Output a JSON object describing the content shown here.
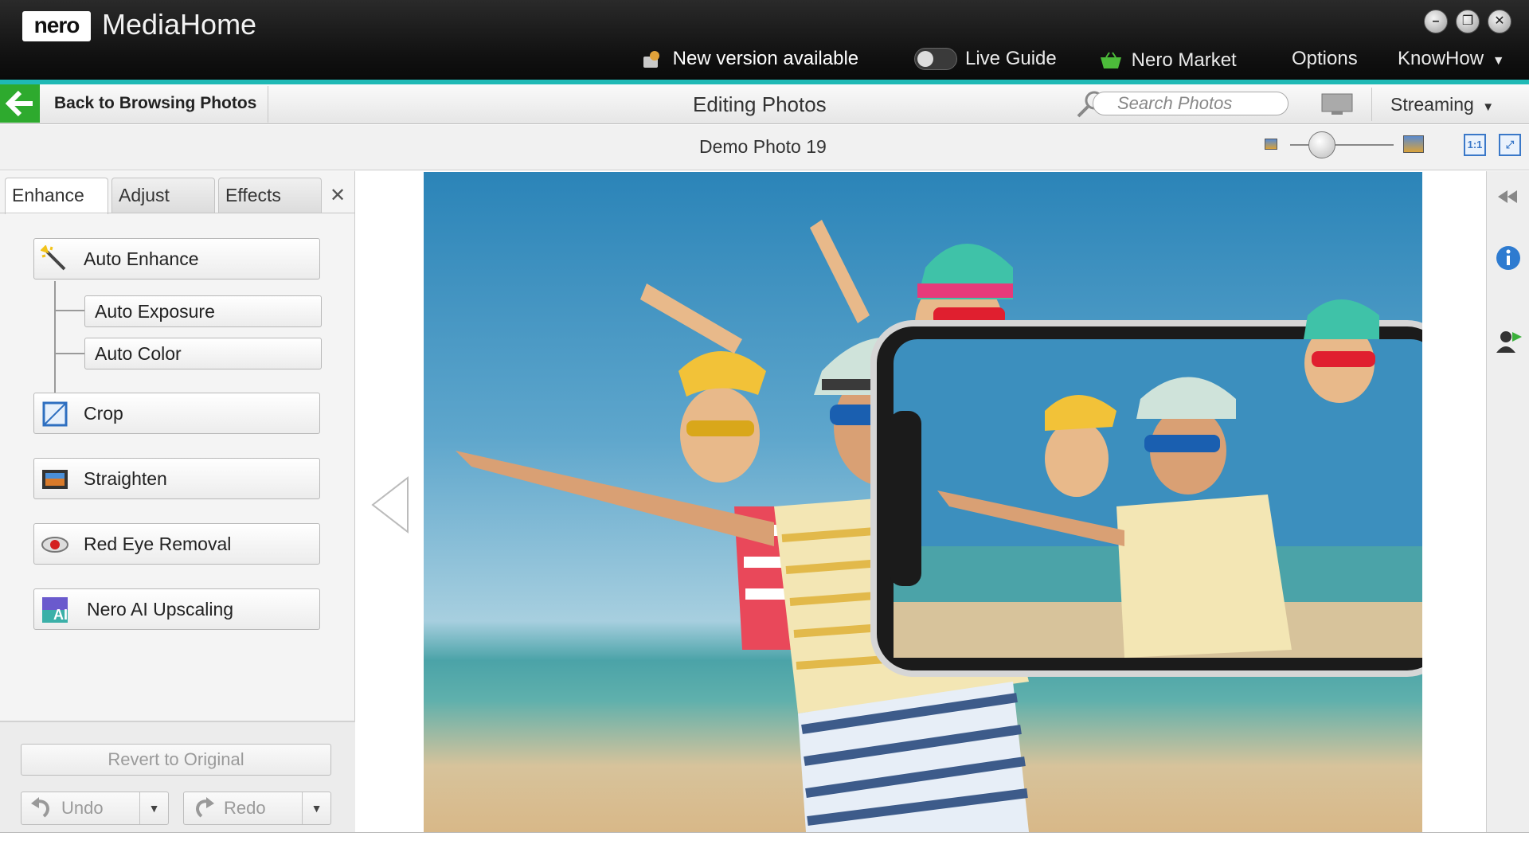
{
  "app": {
    "logo": "nero",
    "title": "MediaHome"
  },
  "window_controls": {
    "minimize": "–",
    "maximize": "❐",
    "close": "✕"
  },
  "top_menu": {
    "new_version": "New version available",
    "live_guide": "Live Guide",
    "nero_market": "Nero Market",
    "options": "Options",
    "knowhow": "KnowHow"
  },
  "navbar": {
    "back_label": "Back to Browsing Photos",
    "title": "Editing Photos",
    "search_placeholder": "Search Photos",
    "streaming": "Streaming"
  },
  "infobar": {
    "photo_name": "Demo Photo 19",
    "one_to_one": "1:1"
  },
  "panel": {
    "tabs": [
      "Enhance",
      "Adjust",
      "Effects"
    ],
    "close": "✕",
    "tools": {
      "auto_enhance": "Auto Enhance",
      "auto_exposure": "Auto Exposure",
      "auto_color": "Auto Color",
      "crop": "Crop",
      "straighten": "Straighten",
      "red_eye": "Red Eye Removal",
      "ai_upscaling": "Nero AI Upscaling"
    },
    "revert": "Revert to Original",
    "undo": "Undo",
    "redo": "Redo"
  },
  "colors": {
    "accent_teal": "#1fb9b5",
    "back_green": "#2eaa2e",
    "view_blue": "#3a78c8"
  }
}
